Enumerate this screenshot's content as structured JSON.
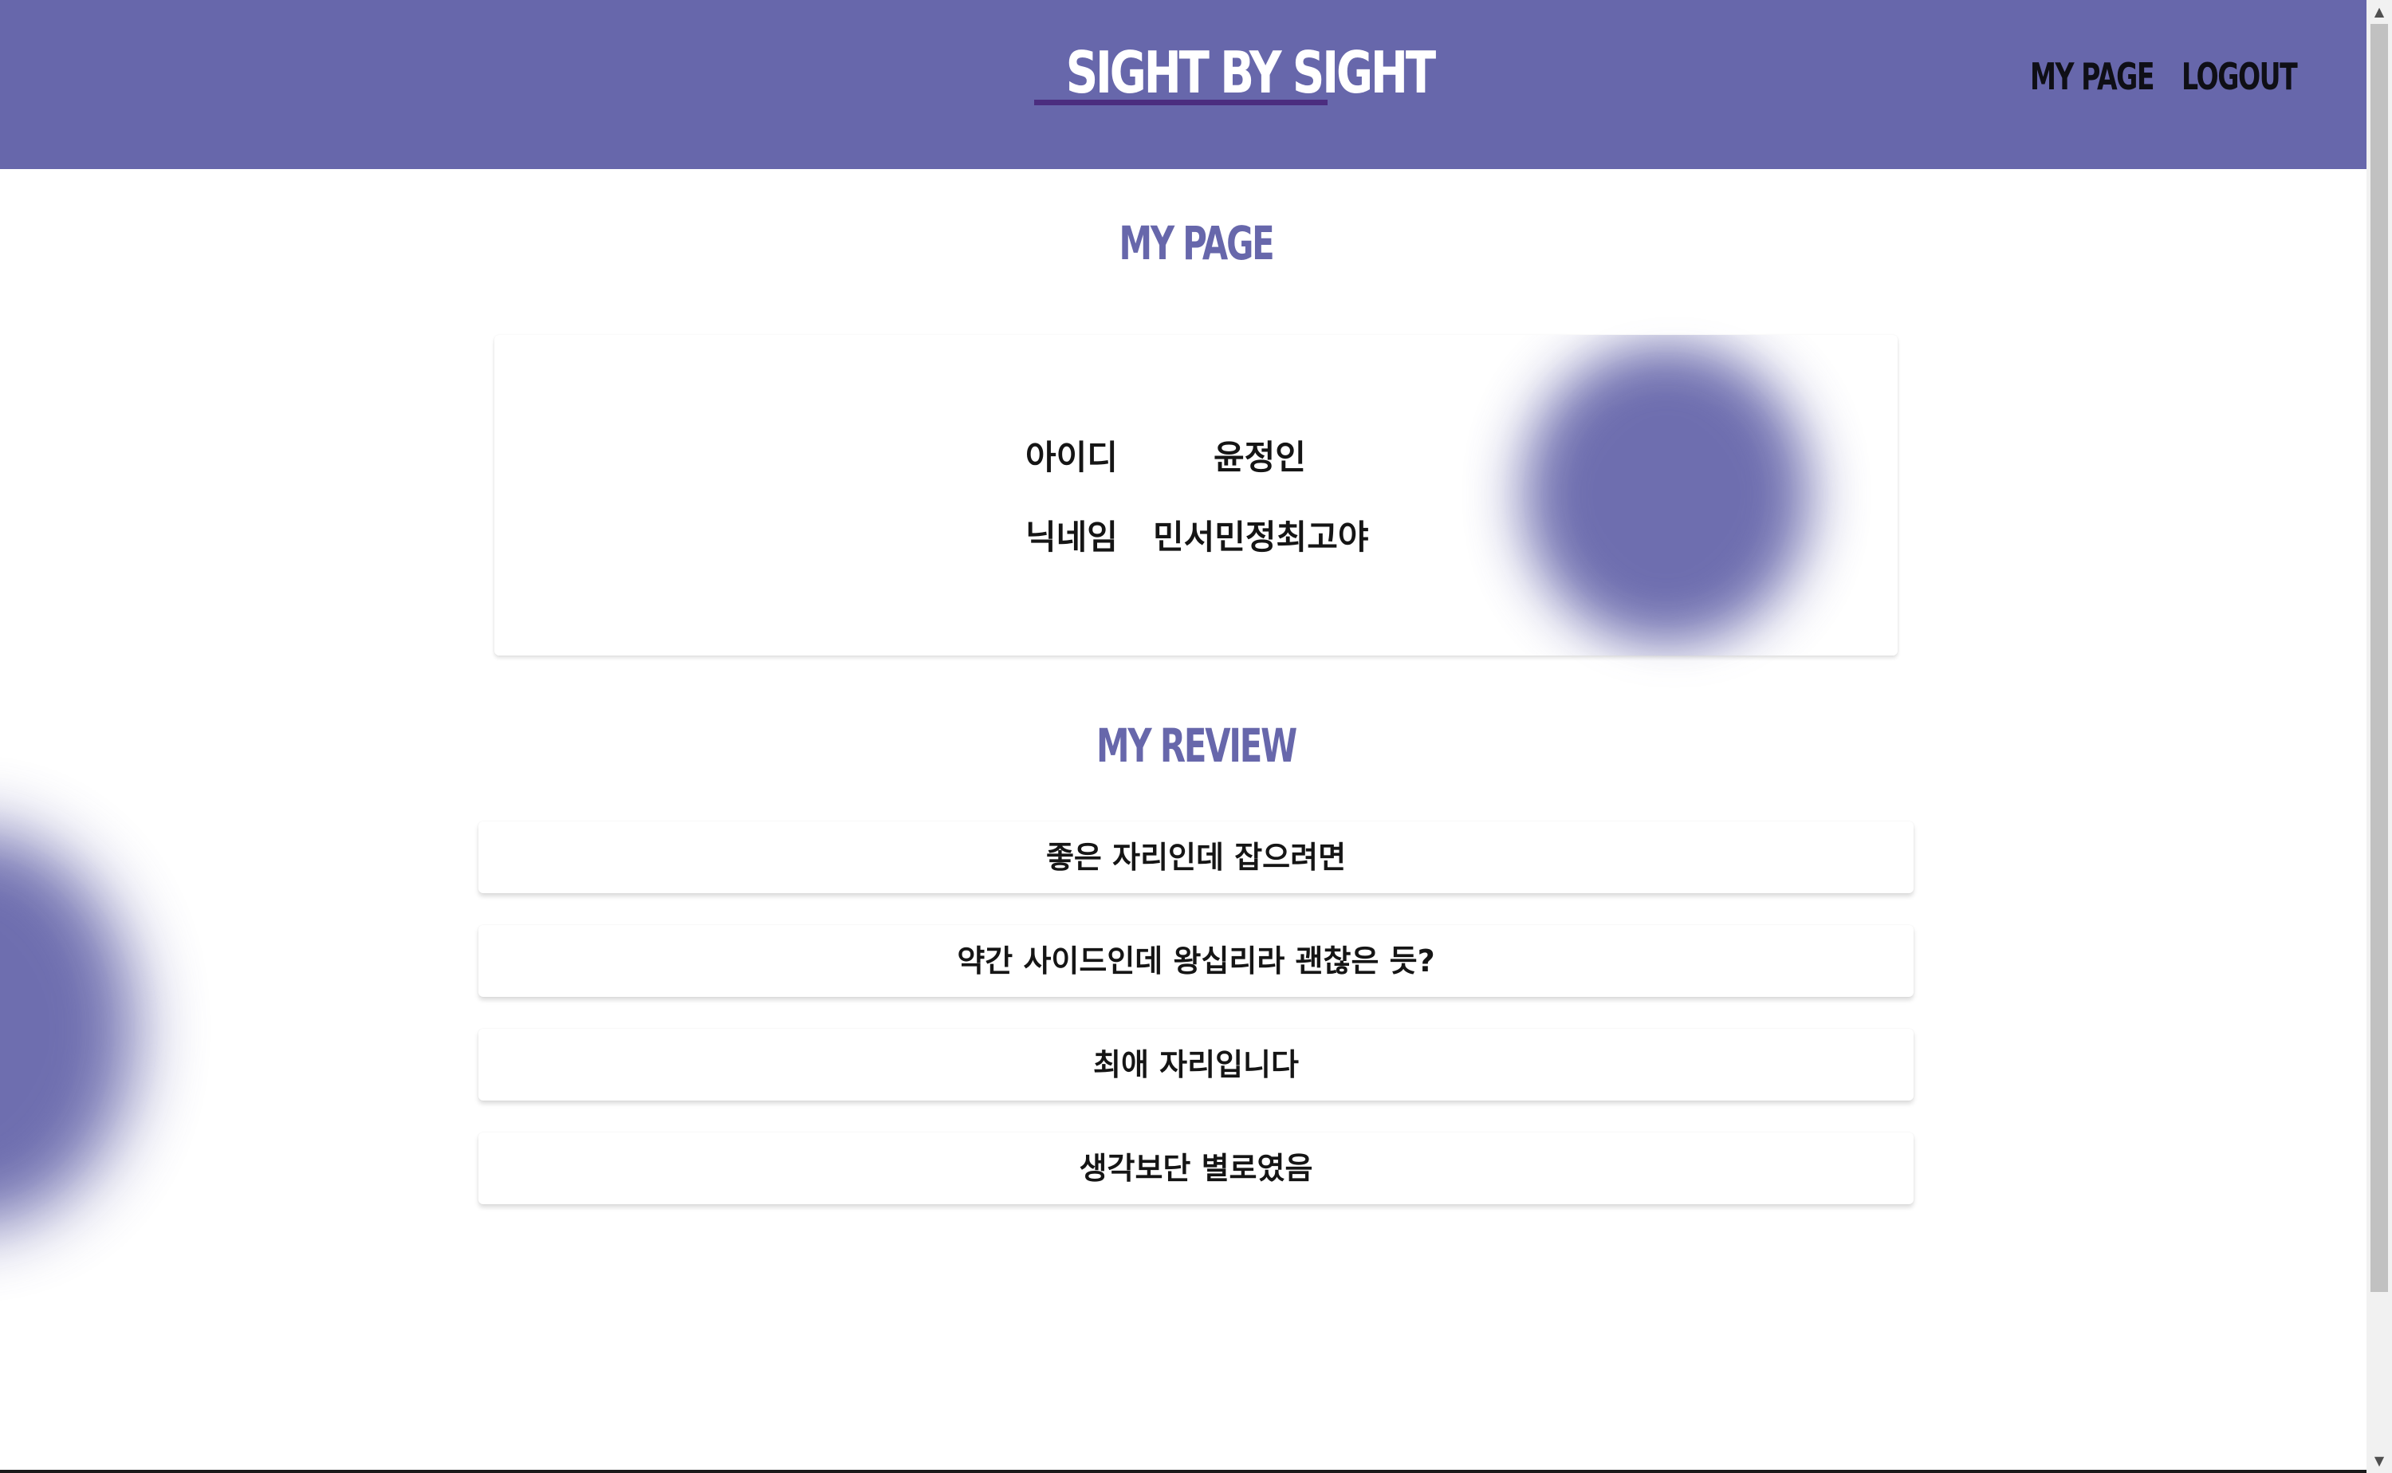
{
  "header": {
    "brand": "SIGHT BY SIGHT",
    "nav": {
      "mypage": "MY PAGE",
      "logout": "LOGOUT"
    }
  },
  "profile": {
    "title": "MY PAGE",
    "id_label": "아이디",
    "id_value": "윤정인",
    "nickname_label": "닉네임",
    "nickname_value": "민서민정최고야"
  },
  "reviews": {
    "title": "MY REVIEW",
    "items": [
      "좋은 자리인데 잡으려면",
      "약간 사이드인데 왕십리라 괜찮은 듯?",
      "최애 자리입니다",
      "생각보단 별로였음"
    ]
  },
  "colors": {
    "primary": "#6767ab",
    "brand_underline": "#4b2d7f",
    "text": "#151515"
  },
  "scrollbar": {
    "up_icon": "▲",
    "down_icon": "▼"
  }
}
